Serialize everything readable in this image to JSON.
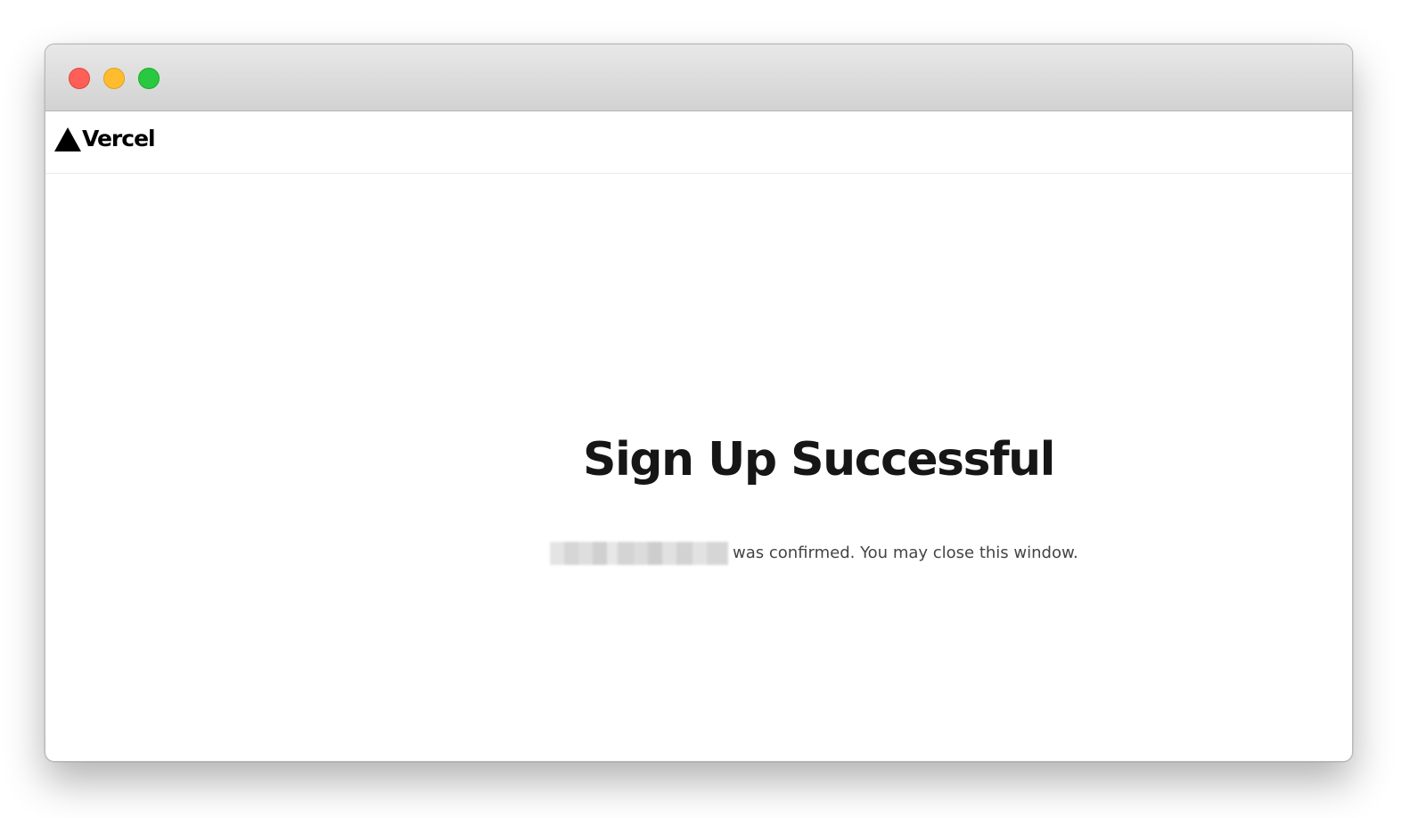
{
  "window": {
    "controls": [
      "close",
      "minimize",
      "maximize"
    ]
  },
  "navbar": {
    "logo_icon": "triangle-logo-icon",
    "brand": "Vercel"
  },
  "main": {
    "title": "Sign Up Successful",
    "message": "was confirmed. You may close this window."
  }
}
